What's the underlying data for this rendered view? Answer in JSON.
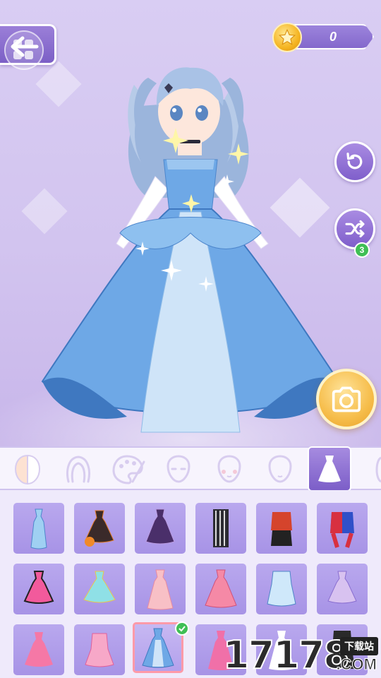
{
  "coins": {
    "value": "0"
  },
  "shuffle": {
    "count": "3"
  },
  "categories": [
    {
      "name": "skin-tone"
    },
    {
      "name": "hair"
    },
    {
      "name": "face-paint"
    },
    {
      "name": "face"
    },
    {
      "name": "face-blush"
    },
    {
      "name": "head"
    },
    {
      "name": "dress"
    },
    {
      "name": "more"
    }
  ],
  "active_category": "dress",
  "items": [
    {
      "kind": "blue-mermaid-gown"
    },
    {
      "kind": "halloween-dress"
    },
    {
      "kind": "purple-gothic-dress"
    },
    {
      "kind": "striped-goth-outfit"
    },
    {
      "kind": "red-black-outfit"
    },
    {
      "kind": "jester-outfit"
    },
    {
      "kind": "pink-black-lolita"
    },
    {
      "kind": "aqua-fairy-dress"
    },
    {
      "kind": "peach-gown"
    },
    {
      "kind": "pink-ballgown"
    },
    {
      "kind": "sailor-dress"
    },
    {
      "kind": "lavender-lolita"
    },
    {
      "kind": "pink-frill-dress"
    },
    {
      "kind": "pink-ribbon-dress"
    },
    {
      "kind": "blue-princess-gown"
    },
    {
      "kind": "pink-slit-gown"
    },
    {
      "kind": "white-dress"
    },
    {
      "kind": "black-outfit"
    }
  ],
  "selected_item": "blue-princess-gown",
  "watermark": {
    "number": "17178",
    "tag": "下载站",
    "domain": ".COM"
  },
  "colors": {
    "accent": "#8a6ed0",
    "gold": "#f6bd4a",
    "badge": "#3fbf55",
    "dress": "#6ea8e6"
  }
}
